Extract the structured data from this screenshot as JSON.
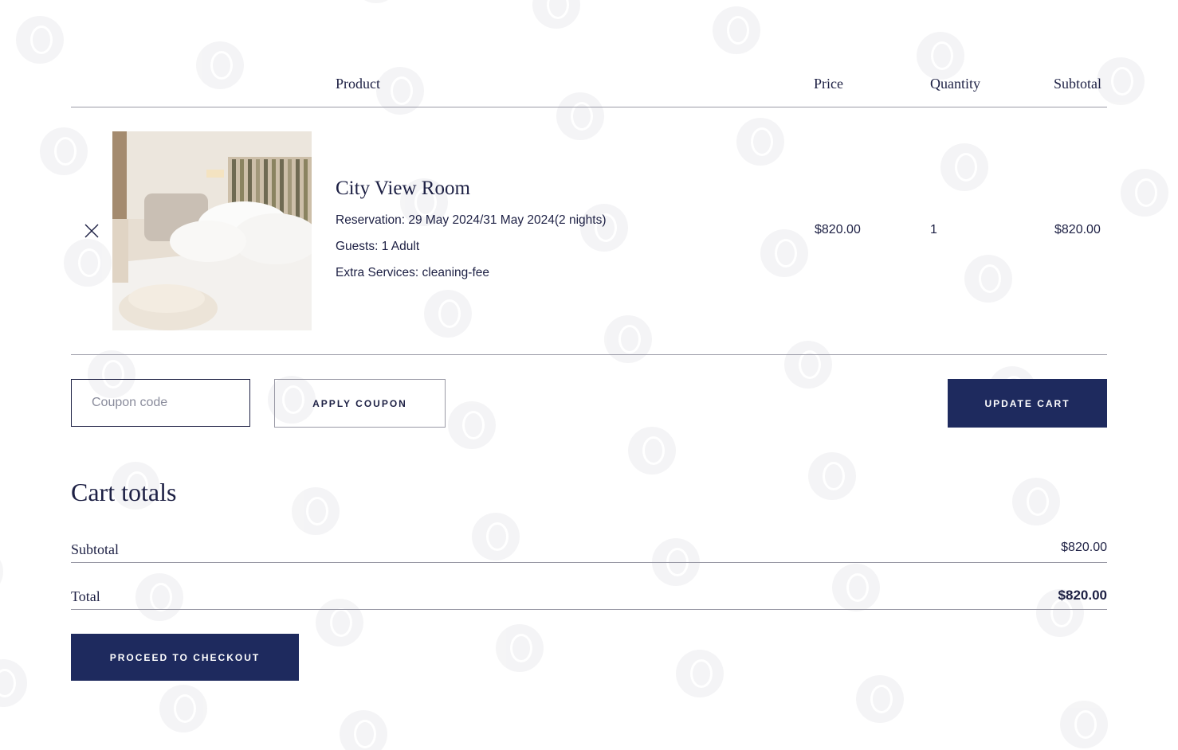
{
  "cart_table": {
    "headers": {
      "product": "Product",
      "price": "Price",
      "quantity": "Quantity",
      "subtotal": "Subtotal"
    },
    "items": [
      {
        "name": "City View Room",
        "reservation_label": "Reservation:",
        "reservation_value": "29 May 2024/31 May 2024(2 nights)",
        "guests_label": "Guests:",
        "guests_value": "1 Adult",
        "extras_label": "Extra Services:",
        "extras_value": "cleaning-fee",
        "price": "$820.00",
        "quantity": "1",
        "subtotal": "$820.00",
        "image_icon": "hotel-room-photo"
      }
    ]
  },
  "coupon": {
    "placeholder": "Coupon code",
    "apply_label": "APPLY COUPON"
  },
  "update_cart_label": "UPDATE CART",
  "cart_totals": {
    "title": "Cart totals",
    "subtotal_label": "Subtotal",
    "subtotal_value": "$820.00",
    "total_label": "Total",
    "total_value": "$820.00"
  },
  "checkout_label": "PROCEED TO CHECKOUT",
  "colors": {
    "accent": "#1e2a5e",
    "text": "#1d2044",
    "divider": "#9a9aa6"
  }
}
